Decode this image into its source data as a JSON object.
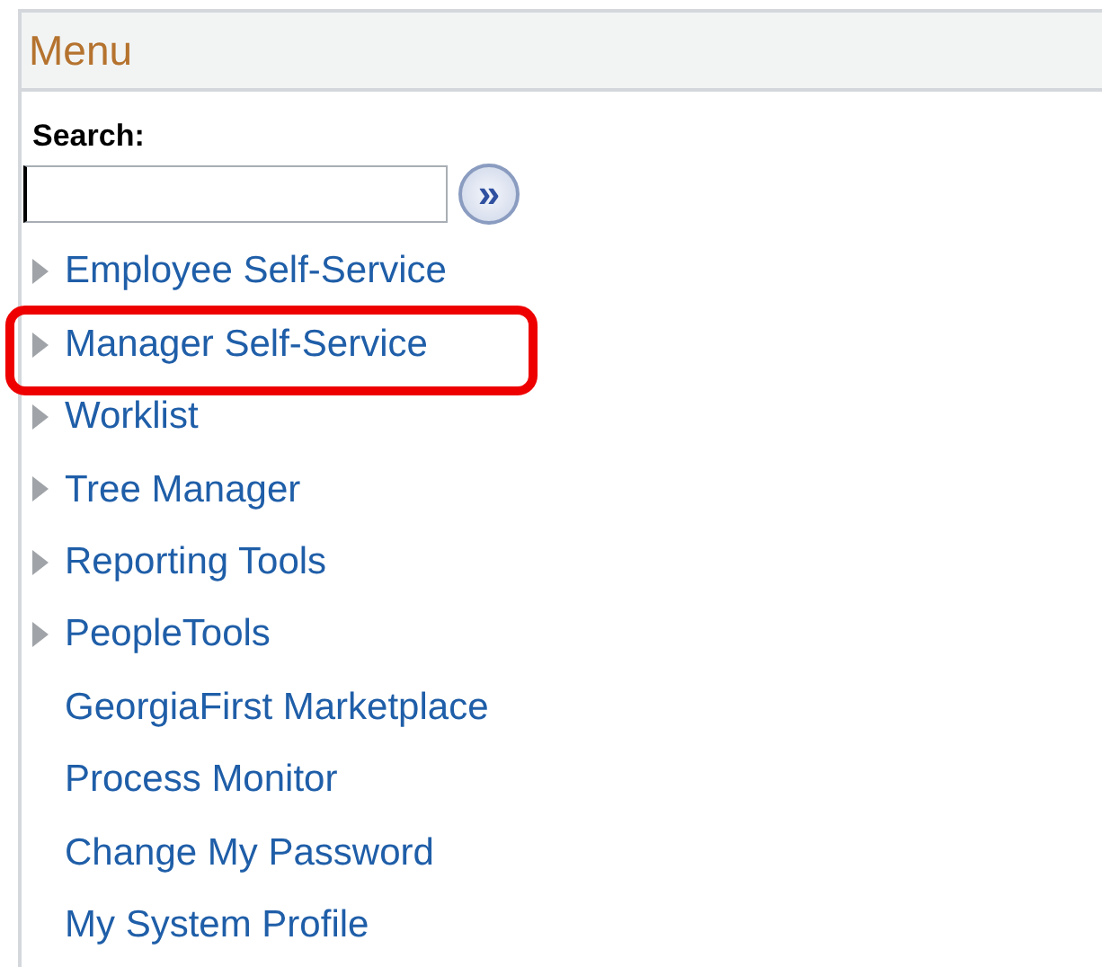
{
  "panel": {
    "title": "Menu"
  },
  "search": {
    "label": "Search:",
    "button": "»"
  },
  "items": [
    {
      "label": "Employee Self-Service",
      "kind": "folder",
      "highlighted": false
    },
    {
      "label": "Manager Self-Service",
      "kind": "folder",
      "highlighted": true
    },
    {
      "label": "Worklist",
      "kind": "folder",
      "highlighted": false
    },
    {
      "label": "Tree Manager",
      "kind": "folder",
      "highlighted": false
    },
    {
      "label": "Reporting Tools",
      "kind": "folder",
      "highlighted": false
    },
    {
      "label": "PeopleTools",
      "kind": "folder",
      "highlighted": false
    },
    {
      "label": "GeorgiaFirst Marketplace",
      "kind": "link",
      "highlighted": false
    },
    {
      "label": "Process Monitor",
      "kind": "link",
      "highlighted": false
    },
    {
      "label": "Change My Password",
      "kind": "link",
      "highlighted": false
    },
    {
      "label": "My System Profile",
      "kind": "link",
      "highlighted": false
    }
  ]
}
